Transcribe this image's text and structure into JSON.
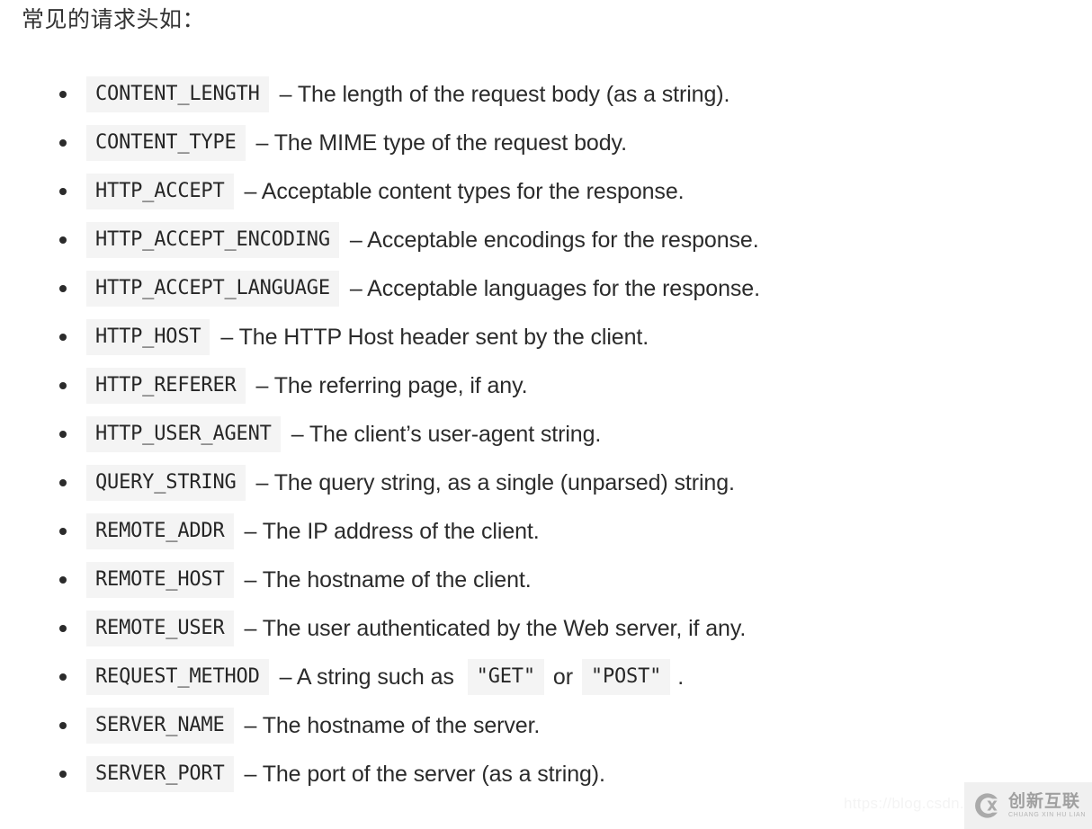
{
  "intro": "常见的请求头如：",
  "headers": [
    {
      "name": "CONTENT_LENGTH",
      "desc": "– The length of the request body (as a string)."
    },
    {
      "name": "CONTENT_TYPE",
      "desc": "– The MIME type of the request body."
    },
    {
      "name": "HTTP_ACCEPT",
      "desc": "– Acceptable content types for the response."
    },
    {
      "name": "HTTP_ACCEPT_ENCODING",
      "desc": "– Acceptable encodings for the response."
    },
    {
      "name": "HTTP_ACCEPT_LANGUAGE",
      "desc": "– Acceptable languages for the response."
    },
    {
      "name": "HTTP_HOST",
      "desc": "– The HTTP Host header sent by the client."
    },
    {
      "name": "HTTP_REFERER",
      "desc": "– The referring page, if any."
    },
    {
      "name": "HTTP_USER_AGENT",
      "desc": "– The client’s user-agent string."
    },
    {
      "name": "QUERY_STRING",
      "desc": "– The query string, as a single (unparsed) string."
    },
    {
      "name": "REMOTE_ADDR",
      "desc": "– The IP address of the client."
    },
    {
      "name": "REMOTE_HOST",
      "desc": "– The hostname of the client."
    },
    {
      "name": "REMOTE_USER",
      "desc": "– The user authenticated by the Web server, if any."
    },
    {
      "name": "REQUEST_METHOD",
      "desc_before": "– A string such as",
      "code_1": "\"GET\"",
      "desc_middle": "or",
      "code_2": "\"POST\"",
      "desc_after": "."
    },
    {
      "name": "SERVER_NAME",
      "desc": "– The hostname of the server."
    },
    {
      "name": "SERVER_PORT",
      "desc": "– The port of the server (as a string)."
    }
  ],
  "watermark": {
    "url": "https://blog.csdn.ne",
    "logo_cn": "创新互联",
    "logo_en": "CHUANG XIN HU LIAN",
    "logo_letters": "CX"
  },
  "colors": {
    "page_background": "#ffffff",
    "text": "#2b2b2b",
    "code_background": "#f4f4f4",
    "code_text": "#262626",
    "watermark": "#f4f4f4",
    "logo_gray": "#9a9a9a"
  }
}
